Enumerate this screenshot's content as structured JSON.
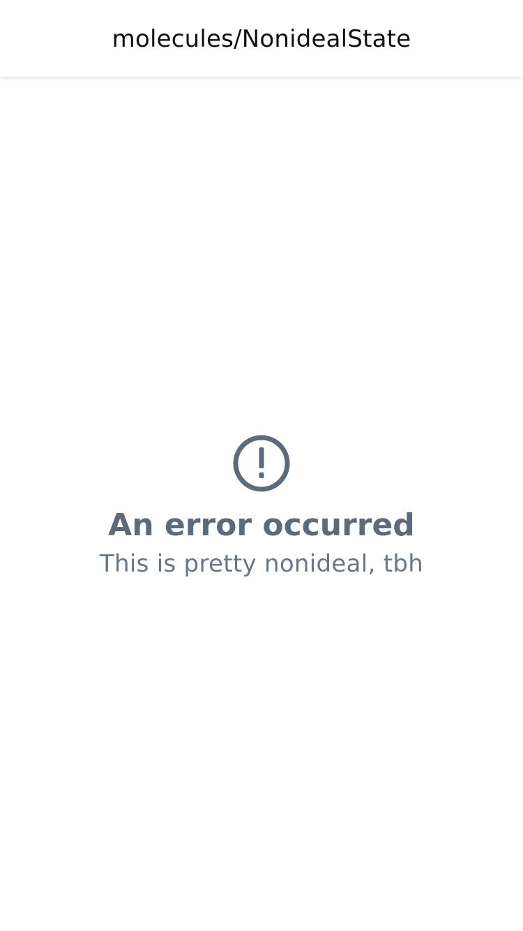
{
  "header": {
    "title": "molecules/NonidealState"
  },
  "state": {
    "icon": "exclamation-circle-icon",
    "title": "An error occurred",
    "subtitle": "This is pretty nonideal, tbh",
    "color": "#5b6b7b"
  }
}
